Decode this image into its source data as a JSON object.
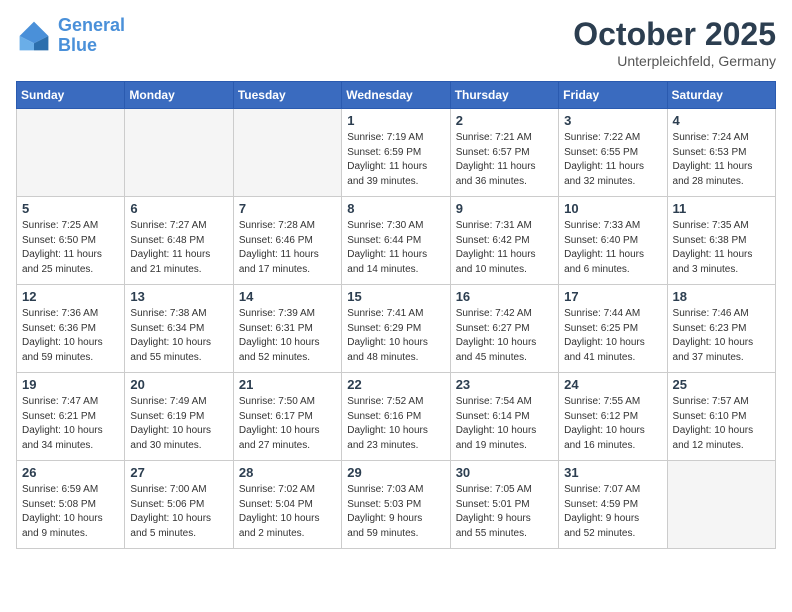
{
  "header": {
    "logo_line1": "General",
    "logo_line2": "Blue",
    "month": "October 2025",
    "location": "Unterpleichfeld, Germany"
  },
  "days_of_week": [
    "Sunday",
    "Monday",
    "Tuesday",
    "Wednesday",
    "Thursday",
    "Friday",
    "Saturday"
  ],
  "weeks": [
    [
      {
        "day": "",
        "info": ""
      },
      {
        "day": "",
        "info": ""
      },
      {
        "day": "",
        "info": ""
      },
      {
        "day": "1",
        "info": "Sunrise: 7:19 AM\nSunset: 6:59 PM\nDaylight: 11 hours\nand 39 minutes."
      },
      {
        "day": "2",
        "info": "Sunrise: 7:21 AM\nSunset: 6:57 PM\nDaylight: 11 hours\nand 36 minutes."
      },
      {
        "day": "3",
        "info": "Sunrise: 7:22 AM\nSunset: 6:55 PM\nDaylight: 11 hours\nand 32 minutes."
      },
      {
        "day": "4",
        "info": "Sunrise: 7:24 AM\nSunset: 6:53 PM\nDaylight: 11 hours\nand 28 minutes."
      }
    ],
    [
      {
        "day": "5",
        "info": "Sunrise: 7:25 AM\nSunset: 6:50 PM\nDaylight: 11 hours\nand 25 minutes."
      },
      {
        "day": "6",
        "info": "Sunrise: 7:27 AM\nSunset: 6:48 PM\nDaylight: 11 hours\nand 21 minutes."
      },
      {
        "day": "7",
        "info": "Sunrise: 7:28 AM\nSunset: 6:46 PM\nDaylight: 11 hours\nand 17 minutes."
      },
      {
        "day": "8",
        "info": "Sunrise: 7:30 AM\nSunset: 6:44 PM\nDaylight: 11 hours\nand 14 minutes."
      },
      {
        "day": "9",
        "info": "Sunrise: 7:31 AM\nSunset: 6:42 PM\nDaylight: 11 hours\nand 10 minutes."
      },
      {
        "day": "10",
        "info": "Sunrise: 7:33 AM\nSunset: 6:40 PM\nDaylight: 11 hours\nand 6 minutes."
      },
      {
        "day": "11",
        "info": "Sunrise: 7:35 AM\nSunset: 6:38 PM\nDaylight: 11 hours\nand 3 minutes."
      }
    ],
    [
      {
        "day": "12",
        "info": "Sunrise: 7:36 AM\nSunset: 6:36 PM\nDaylight: 10 hours\nand 59 minutes."
      },
      {
        "day": "13",
        "info": "Sunrise: 7:38 AM\nSunset: 6:34 PM\nDaylight: 10 hours\nand 55 minutes."
      },
      {
        "day": "14",
        "info": "Sunrise: 7:39 AM\nSunset: 6:31 PM\nDaylight: 10 hours\nand 52 minutes."
      },
      {
        "day": "15",
        "info": "Sunrise: 7:41 AM\nSunset: 6:29 PM\nDaylight: 10 hours\nand 48 minutes."
      },
      {
        "day": "16",
        "info": "Sunrise: 7:42 AM\nSunset: 6:27 PM\nDaylight: 10 hours\nand 45 minutes."
      },
      {
        "day": "17",
        "info": "Sunrise: 7:44 AM\nSunset: 6:25 PM\nDaylight: 10 hours\nand 41 minutes."
      },
      {
        "day": "18",
        "info": "Sunrise: 7:46 AM\nSunset: 6:23 PM\nDaylight: 10 hours\nand 37 minutes."
      }
    ],
    [
      {
        "day": "19",
        "info": "Sunrise: 7:47 AM\nSunset: 6:21 PM\nDaylight: 10 hours\nand 34 minutes."
      },
      {
        "day": "20",
        "info": "Sunrise: 7:49 AM\nSunset: 6:19 PM\nDaylight: 10 hours\nand 30 minutes."
      },
      {
        "day": "21",
        "info": "Sunrise: 7:50 AM\nSunset: 6:17 PM\nDaylight: 10 hours\nand 27 minutes."
      },
      {
        "day": "22",
        "info": "Sunrise: 7:52 AM\nSunset: 6:16 PM\nDaylight: 10 hours\nand 23 minutes."
      },
      {
        "day": "23",
        "info": "Sunrise: 7:54 AM\nSunset: 6:14 PM\nDaylight: 10 hours\nand 19 minutes."
      },
      {
        "day": "24",
        "info": "Sunrise: 7:55 AM\nSunset: 6:12 PM\nDaylight: 10 hours\nand 16 minutes."
      },
      {
        "day": "25",
        "info": "Sunrise: 7:57 AM\nSunset: 6:10 PM\nDaylight: 10 hours\nand 12 minutes."
      }
    ],
    [
      {
        "day": "26",
        "info": "Sunrise: 6:59 AM\nSunset: 5:08 PM\nDaylight: 10 hours\nand 9 minutes."
      },
      {
        "day": "27",
        "info": "Sunrise: 7:00 AM\nSunset: 5:06 PM\nDaylight: 10 hours\nand 5 minutes."
      },
      {
        "day": "28",
        "info": "Sunrise: 7:02 AM\nSunset: 5:04 PM\nDaylight: 10 hours\nand 2 minutes."
      },
      {
        "day": "29",
        "info": "Sunrise: 7:03 AM\nSunset: 5:03 PM\nDaylight: 9 hours\nand 59 minutes."
      },
      {
        "day": "30",
        "info": "Sunrise: 7:05 AM\nSunset: 5:01 PM\nDaylight: 9 hours\nand 55 minutes."
      },
      {
        "day": "31",
        "info": "Sunrise: 7:07 AM\nSunset: 4:59 PM\nDaylight: 9 hours\nand 52 minutes."
      },
      {
        "day": "",
        "info": ""
      }
    ]
  ]
}
